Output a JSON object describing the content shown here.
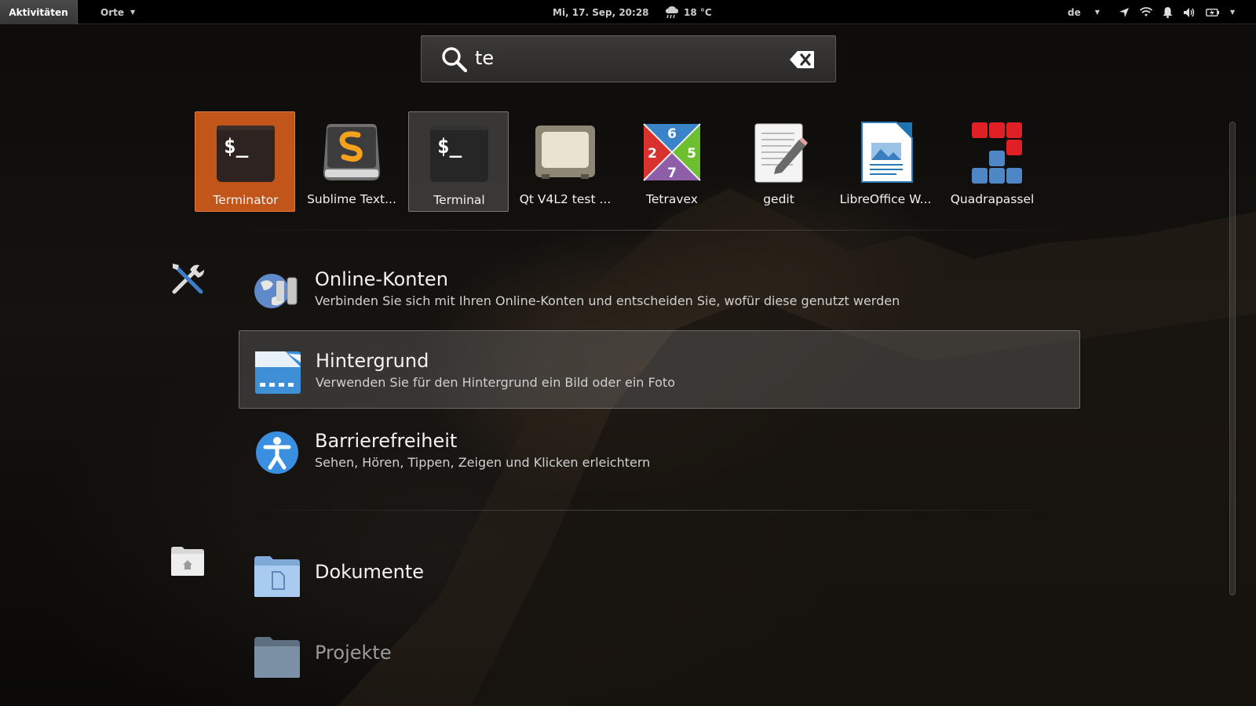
{
  "topbar": {
    "activities": "Aktivitäten",
    "places": "Orte",
    "clock": "Mi, 17. Sep, 20:28",
    "weather": "18 °C",
    "language": "de"
  },
  "search": {
    "query": "te"
  },
  "apps": [
    {
      "label": "Terminator",
      "icon": "terminator-icon"
    },
    {
      "label": "Sublime Text...",
      "icon": "sublime-text-icon"
    },
    {
      "label": "Terminal",
      "icon": "terminal-icon"
    },
    {
      "label": "Qt V4L2 test ...",
      "icon": "qv4l2-icon"
    },
    {
      "label": "Tetravex",
      "icon": "tetravex-icon"
    },
    {
      "label": "gedit",
      "icon": "gedit-icon"
    },
    {
      "label": "LibreOffice W...",
      "icon": "libreoffice-writer-icon"
    },
    {
      "label": "Quadrapassel",
      "icon": "quadrapassel-icon"
    }
  ],
  "tetravex_digits": [
    "6",
    "2",
    "5",
    "7"
  ],
  "settings_results": [
    {
      "title": "Online-Konten",
      "desc": "Verbinden Sie sich mit Ihren Online-Konten und entscheiden Sie, wofür diese genutzt werden"
    },
    {
      "title": "Hintergrund",
      "desc": "Verwenden Sie für den Hintergrund ein Bild oder ein Foto"
    },
    {
      "title": "Barrierefreiheit",
      "desc": "Sehen, Hören, Tippen, Zeigen und Klicken erleichtern"
    }
  ],
  "files_results": [
    {
      "title": "Dokumente"
    },
    {
      "title": "Projekte"
    }
  ],
  "colors": {
    "selected": "#c2551a",
    "topbar": "#000000"
  }
}
